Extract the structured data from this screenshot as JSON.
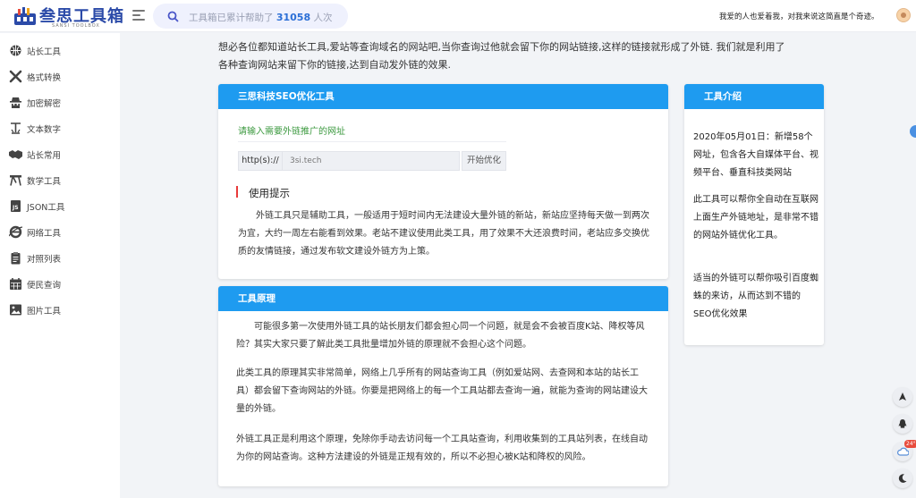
{
  "header": {
    "logo_text": "叁思工具箱",
    "logo_sub": "SANSI TOOLBOX",
    "search_prefix": "工具箱已累计帮助了",
    "search_count": "31058",
    "search_suffix": "人次",
    "marquee": "我爱的人也爱着我，对我来说这简直是个奇迹。"
  },
  "sidebar": {
    "items": [
      {
        "label": "站长工具",
        "icon": "globe-icon"
      },
      {
        "label": "格式转换",
        "icon": "tools-icon"
      },
      {
        "label": "加密解密",
        "icon": "spy-icon"
      },
      {
        "label": "文本数字",
        "icon": "text-icon"
      },
      {
        "label": "站长常用",
        "icon": "handshake-icon"
      },
      {
        "label": "数学工具",
        "icon": "compass-icon"
      },
      {
        "label": "JSON工具",
        "icon": "js-icon"
      },
      {
        "label": "网络工具",
        "icon": "ie-icon"
      },
      {
        "label": "对照列表",
        "icon": "clipboard-icon"
      },
      {
        "label": "便民查询",
        "icon": "calendar-icon"
      },
      {
        "label": "图片工具",
        "icon": "image-icon"
      }
    ]
  },
  "intro": "想必各位都知道站长工具,爱站等查询域名的网站吧,当你查询过他就会留下你的网站链接,这样的链接就形成了外链. 我们就是利用了各种查询网站来留下你的链接,达到自动发外链的效果.",
  "tool_card": {
    "title": "三思科技SEO优化工具",
    "url_label": "请输入需要外链推广的网址",
    "prefix": "http(s)://",
    "input_value": "3si.tech",
    "button": "开始优化",
    "tips_title": "使用提示",
    "tips_text": "外链工具只是辅助工具，一般适用于短时间内无法建设大量外链的新站，新站应坚持每天做一到两次为宜，大约一周左右能看到效果。老站不建议使用此类工具，用了效果不大还浪费时间，老站应多交换优质的友情链接，通过发布软文建设外链方为上策。"
  },
  "info_card": {
    "title": "工具介绍",
    "p1": "2020年05月01日：新增58个网址，包含各大自媒体平台、视频平台、垂直科技类网站",
    "p2": "此工具可以帮你全自动在互联网上面生产外链地址，是非常不错的网站外链优化工具。",
    "p3": "适当的外链可以帮你吸引百度蜘蛛的来访，从而达到不错的SEO优化效果"
  },
  "principle_card": {
    "title": "工具原理",
    "p1": "可能很多第一次使用外链工具的站长朋友们都会担心同一个问题，就是会不会被百度K站、降权等风险？其实大家只要了解此类工具批量增加外链的原理就不会担心这个问题。",
    "p2": "此类工具的原理其实非常简单，网络上几乎所有的网站查询工具（例如爱站网、去查网和本站的站长工具）都会留下查询网站的外链。你要是把网络上的每一个工具站都去查询一遍，就能为查询的网站建设大量的外链。",
    "p3": "外链工具正是利用这个原理，免除你手动去访问每一个工具站查询，利用收集到的工具站列表，在线自动为你的网站查询。这种方法建设的外链是正规有效的，所以不必担心被K站和降权的风险。"
  },
  "float": {
    "temperature": "24°"
  }
}
